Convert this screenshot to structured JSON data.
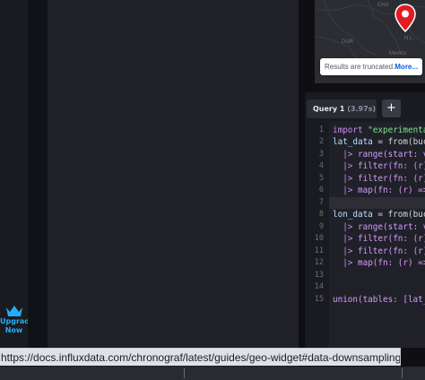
{
  "sidebar": {
    "upgrade": {
      "line1": "Upgrade",
      "line2": "Now",
      "icon": "crown-icon"
    }
  },
  "map": {
    "labels": [
      "CHA",
      "DUR",
      "Mexico",
      "N.L."
    ],
    "truncated_text": "Results are truncated.",
    "more_link": "More..."
  },
  "query": {
    "tab_label": "Query 1",
    "tab_time": "(3.97s)",
    "add_label": "+"
  },
  "editor": {
    "lines": [
      {
        "n": "1",
        "text": ""
      },
      {
        "n": "2",
        "text": ""
      },
      {
        "n": "3",
        "text": ""
      },
      {
        "n": "4",
        "text": ""
      },
      {
        "n": "5",
        "text": ""
      },
      {
        "n": "6",
        "text": ""
      },
      {
        "n": "7",
        "text": ""
      },
      {
        "n": "8",
        "text": ""
      },
      {
        "n": "9",
        "text": ""
      },
      {
        "n": "10",
        "text": ""
      },
      {
        "n": "11",
        "text": ""
      },
      {
        "n": "12",
        "text": ""
      },
      {
        "n": "13",
        "text": ""
      },
      {
        "n": "14",
        "text": ""
      },
      {
        "n": "15",
        "text": ""
      }
    ],
    "tokens": {
      "import_kw": "import",
      "import_str": "\"experimenta",
      "lat_data": "lat_data",
      "lon_data": "lon_data",
      "assign_from": "= from(buc",
      "pipe": "|>",
      "range": "range(start: v",
      "filter": "filter(fn: (r)",
      "map": "map(fn: (r) =>",
      "union": "union(tables: [lat_"
    }
  },
  "status_url": "https://docs.influxdata.com/chronograf/latest/guides/geo-widget#data-downsampling"
}
